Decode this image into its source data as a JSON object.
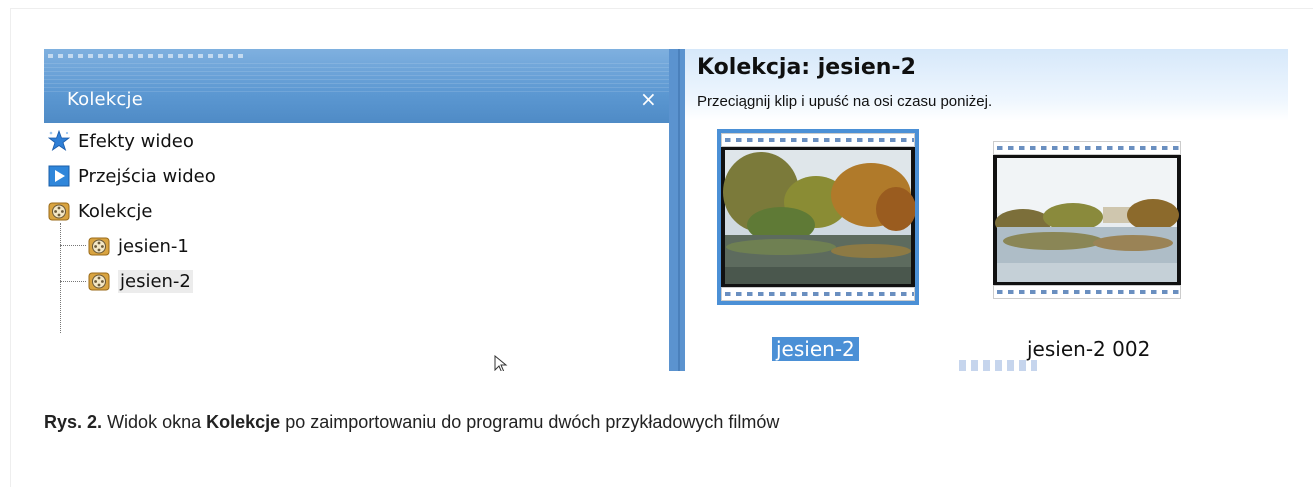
{
  "left_panel": {
    "title": "Kolekcje",
    "close_label": "×",
    "tree": [
      {
        "label": "Efekty wideo",
        "icon": "star-effects-icon"
      },
      {
        "label": "Przejścia wideo",
        "icon": "play-transition-icon"
      },
      {
        "label": "Kolekcje",
        "icon": "film-reel-folder-icon"
      },
      {
        "label": "jesien-1",
        "icon": "film-reel-folder-icon"
      },
      {
        "label": "jesien-2",
        "icon": "film-reel-folder-icon",
        "selected": true
      }
    ]
  },
  "right_panel": {
    "title": "Kolekcja: jesien-2",
    "subtitle": "Przeciągnij klip i upuść na osi czasu poniżej.",
    "clips": [
      {
        "label": "jesien-2",
        "selected": true
      },
      {
        "label": "jesien-2 002",
        "selected": false
      }
    ]
  },
  "caption": {
    "prefix": "Rys. 2.",
    "text_1": "Widok okna",
    "bold_word": "Kolekcje",
    "text_2": "po zaimportowaniu do programu dwóch przykładowych filmów"
  },
  "colors": {
    "header_blue": "#5c98d2",
    "selection_blue": "#4b90d6",
    "divider_blue": "#5b93cf"
  }
}
